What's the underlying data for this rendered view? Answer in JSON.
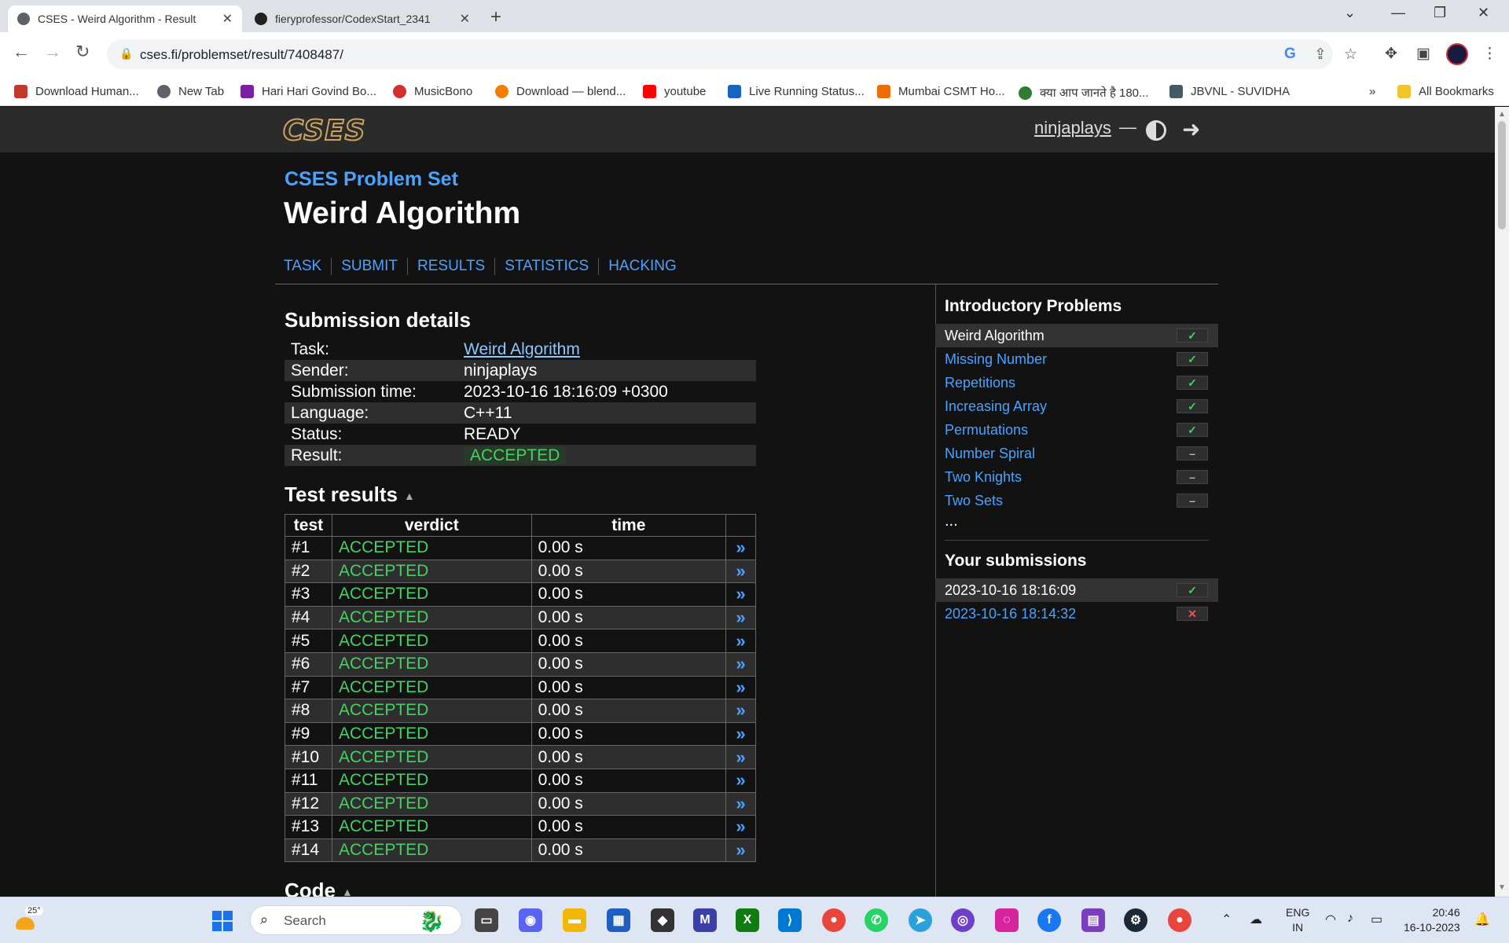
{
  "browser": {
    "tabs": [
      {
        "title": "CSES - Weird Algorithm - Result"
      },
      {
        "title": "fieryprofessor/CodexStart_2341"
      }
    ],
    "url": "cses.fi/problemset/result/7408487/",
    "bookmarks": [
      {
        "label": "Download Human...",
        "color": "#c0392b"
      },
      {
        "label": "New Tab",
        "color": "#5f6368"
      },
      {
        "label": "Hari Hari Govind Bo...",
        "color": "#7b1fa2"
      },
      {
        "label": "MusicBono",
        "color": "#d32f2f"
      },
      {
        "label": "Download — blend...",
        "color": "#f57c00"
      },
      {
        "label": "youtube",
        "color": "#ff0000"
      },
      {
        "label": "Live Running Status...",
        "color": "#1565c0"
      },
      {
        "label": "Mumbai CSMT Ho...",
        "color": "#ef6c00"
      },
      {
        "label": "क्या आप जानते है 180...",
        "color": "#2e7d32"
      },
      {
        "label": "JBVNL - SUVIDHA",
        "color": "#455a64"
      }
    ],
    "all_bookmarks": "All Bookmarks"
  },
  "header": {
    "username": "ninjaplays",
    "dash": "—"
  },
  "page": {
    "problem_set": "CSES Problem Set",
    "title": "Weird Algorithm",
    "nav": [
      "TASK",
      "SUBMIT",
      "RESULTS",
      "STATISTICS",
      "HACKING"
    ]
  },
  "submission": {
    "heading": "Submission details",
    "task_label": "Task:",
    "task_value": "Weird Algorithm",
    "sender_label": "Sender:",
    "sender_value": "ninjaplays",
    "time_label": "Submission time:",
    "time_value": "2023-10-16 18:16:09 +0300",
    "lang_label": "Language:",
    "lang_value": "C++11",
    "status_label": "Status:",
    "status_value": "READY",
    "result_label": "Result:",
    "result_value": "ACCEPTED"
  },
  "tests": {
    "heading": "Test results",
    "columns": [
      "test",
      "verdict",
      "time"
    ],
    "link_glyph": "»",
    "rows": [
      {
        "id": "#1",
        "verdict": "ACCEPTED",
        "time": "0.00 s"
      },
      {
        "id": "#2",
        "verdict": "ACCEPTED",
        "time": "0.00 s"
      },
      {
        "id": "#3",
        "verdict": "ACCEPTED",
        "time": "0.00 s"
      },
      {
        "id": "#4",
        "verdict": "ACCEPTED",
        "time": "0.00 s"
      },
      {
        "id": "#5",
        "verdict": "ACCEPTED",
        "time": "0.00 s"
      },
      {
        "id": "#6",
        "verdict": "ACCEPTED",
        "time": "0.00 s"
      },
      {
        "id": "#7",
        "verdict": "ACCEPTED",
        "time": "0.00 s"
      },
      {
        "id": "#8",
        "verdict": "ACCEPTED",
        "time": "0.00 s"
      },
      {
        "id": "#9",
        "verdict": "ACCEPTED",
        "time": "0.00 s"
      },
      {
        "id": "#10",
        "verdict": "ACCEPTED",
        "time": "0.00 s"
      },
      {
        "id": "#11",
        "verdict": "ACCEPTED",
        "time": "0.00 s"
      },
      {
        "id": "#12",
        "verdict": "ACCEPTED",
        "time": "0.00 s"
      },
      {
        "id": "#13",
        "verdict": "ACCEPTED",
        "time": "0.00 s"
      },
      {
        "id": "#14",
        "verdict": "ACCEPTED",
        "time": "0.00 s"
      }
    ]
  },
  "code_heading": "Code",
  "sidebar": {
    "intro_heading": "Introductory Problems",
    "problems": [
      {
        "name": "Weird Algorithm",
        "status": "solved",
        "mark": "✓",
        "current": true
      },
      {
        "name": "Missing Number",
        "status": "solved",
        "mark": "✓"
      },
      {
        "name": "Repetitions",
        "status": "solved",
        "mark": "✓"
      },
      {
        "name": "Increasing Array",
        "status": "solved",
        "mark": "✓"
      },
      {
        "name": "Permutations",
        "status": "solved",
        "mark": "✓"
      },
      {
        "name": "Number Spiral",
        "status": "unsolved",
        "mark": "–"
      },
      {
        "name": "Two Knights",
        "status": "unsolved",
        "mark": "–"
      },
      {
        "name": "Two Sets",
        "status": "unsolved",
        "mark": "–"
      }
    ],
    "more": "...",
    "subs_heading": "Your submissions",
    "submissions": [
      {
        "time": "2023-10-16 18:16:09",
        "result": "accepted",
        "mark": "✓",
        "current": true
      },
      {
        "time": "2023-10-16 18:14:32",
        "result": "rejected",
        "mark": "✕"
      }
    ]
  },
  "taskbar": {
    "temperature": "25°",
    "search_placeholder": "Search",
    "lang_line1": "ENG",
    "lang_line2": "IN",
    "time": "20:46",
    "date": "16-10-2023"
  },
  "colors": {
    "accent": "#4aa3ff",
    "accepted": "#45d163",
    "rejected": "#e55555",
    "background": "#121212"
  }
}
